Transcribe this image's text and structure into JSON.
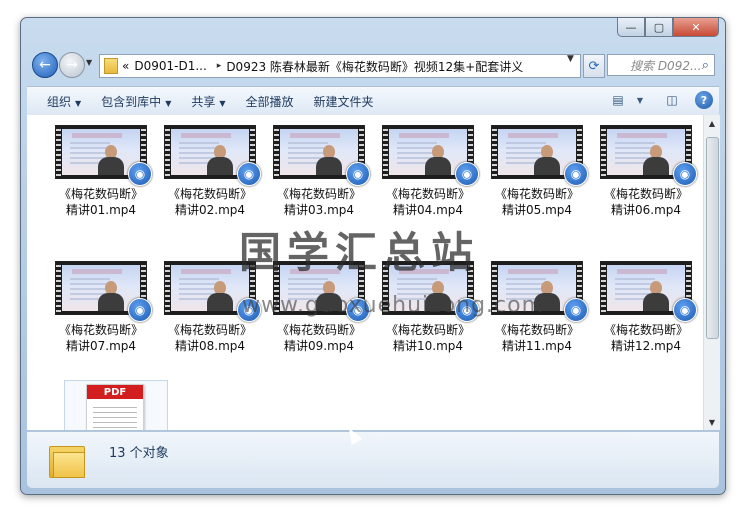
{
  "window": {
    "controls": {
      "minimize": "—",
      "maximize": "▢",
      "close": "✕"
    }
  },
  "address": {
    "back_icon": "back-arrow-icon",
    "crumbs": [
      "«",
      "D0901-D1...",
      "D0923 陈春林最新《梅花数码断》视频12集+配套讲义"
    ],
    "crumb_sep": "▸",
    "search_placeholder": "搜索 D092..."
  },
  "toolbar": {
    "organize": "组织",
    "include_library": "包含到库中",
    "share": "共享",
    "play_all": "全部播放",
    "new_folder": "新建文件夹"
  },
  "files": [
    {
      "line1": "《梅花数码断》",
      "line2": "精讲01.mp4"
    },
    {
      "line1": "《梅花数码断》",
      "line2": "精讲02.mp4"
    },
    {
      "line1": "《梅花数码断》",
      "line2": "精讲03.mp4"
    },
    {
      "line1": "《梅花数码断》",
      "line2": "精讲04.mp4"
    },
    {
      "line1": "《梅花数码断》",
      "line2": "精讲05.mp4"
    },
    {
      "line1": "《梅花数码断》",
      "line2": "精讲06.mp4"
    },
    {
      "line1": "《梅花数码断》",
      "line2": "精讲07.mp4"
    },
    {
      "line1": "《梅花数码断》",
      "line2": "精讲08.mp4"
    },
    {
      "line1": "《梅花数码断》",
      "line2": "精讲09.mp4"
    },
    {
      "line1": "《梅花数码断》",
      "line2": "精讲10.mp4"
    },
    {
      "line1": "《梅花数码断》",
      "line2": "精讲11.mp4"
    },
    {
      "line1": "《梅花数码断》",
      "line2": "精讲12.mp4"
    }
  ],
  "pdf": {
    "tag": "PDF"
  },
  "watermark": {
    "cn": "国学汇总站",
    "url": "www.guoxuehuizong.com"
  },
  "details": {
    "count": "13 个对象"
  }
}
